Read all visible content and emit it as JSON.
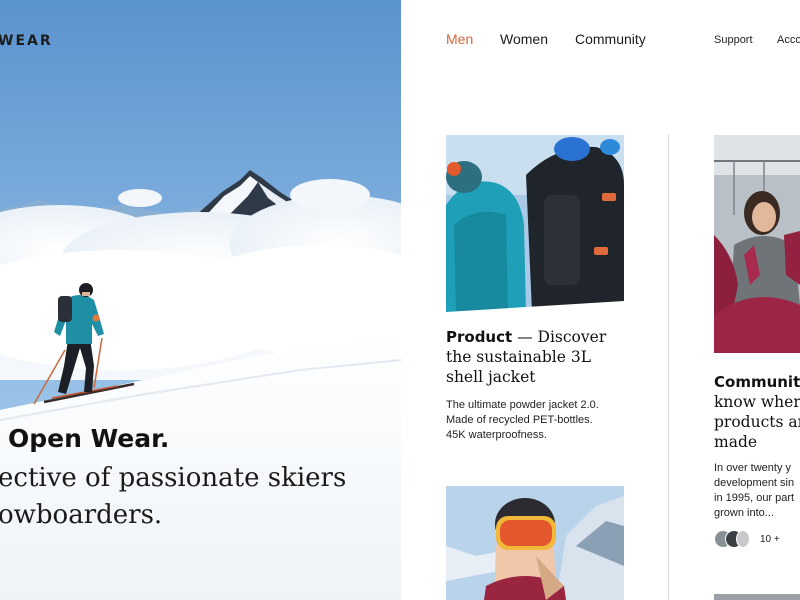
{
  "brand": {
    "logo_text": "WEAR"
  },
  "hero": {
    "title": "Open Wear.",
    "subtitle_lines": [
      "ective of passionate skiers",
      "owboarders."
    ]
  },
  "nav": {
    "primary": [
      {
        "label": "Men",
        "active": true
      },
      {
        "label": "Women",
        "active": false
      },
      {
        "label": "Community",
        "active": false
      }
    ],
    "secondary": [
      {
        "label": "Support"
      },
      {
        "label": "Acco"
      }
    ]
  },
  "cards": [
    {
      "category": "Product",
      "title_lines": [
        " — Discover",
        "the sustainable 3L",
        "shell jacket"
      ],
      "description_lines": [
        "The ultimate powder jacket 2.0.",
        "Made of recycled PET-bottles.",
        "45K waterproofness."
      ]
    },
    {
      "category": "Community",
      "title_lines": [
        "know where",
        "products ar",
        "made"
      ],
      "description_lines": [
        "In over twenty y",
        "development sin",
        "in 1995, our part",
        "grown into..."
      ],
      "participants_count": "10 +"
    }
  ],
  "colors": {
    "accent": "#d9633e",
    "text": "#111111",
    "divider": "#dcdcdc"
  }
}
